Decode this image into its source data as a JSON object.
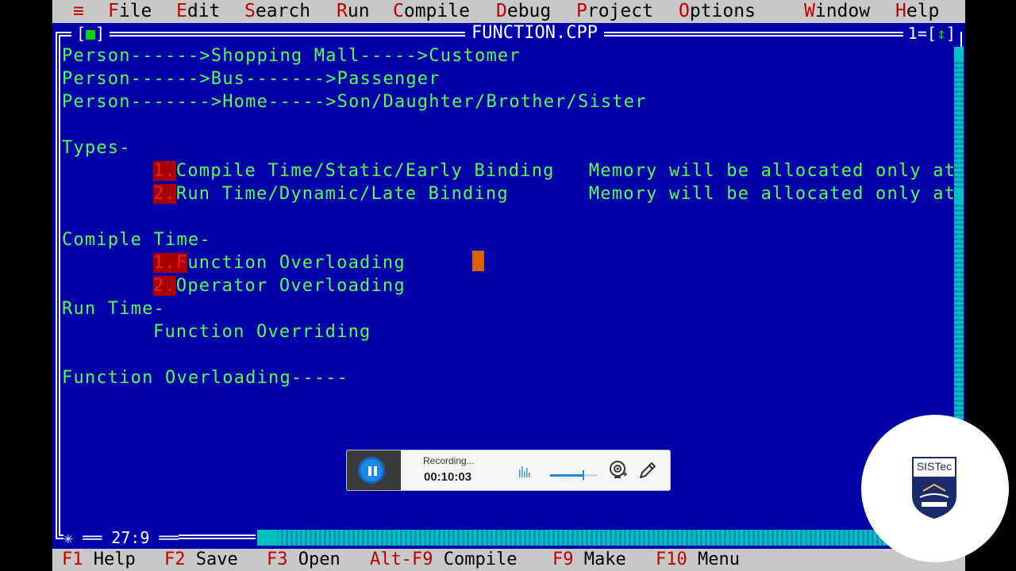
{
  "menubar": {
    "system_menu": "≡",
    "items": [
      {
        "hot": "F",
        "rest": "ile"
      },
      {
        "hot": "E",
        "rest": "dit"
      },
      {
        "hot": "S",
        "rest": "earch"
      },
      {
        "hot": "R",
        "rest": "un"
      },
      {
        "hot": "C",
        "rest": "ompile"
      },
      {
        "hot": "D",
        "rest": "ebug"
      },
      {
        "hot": "P",
        "rest": "roject"
      },
      {
        "hot": "O",
        "rest": "ptions"
      },
      {
        "hot": "W",
        "rest": "indow"
      },
      {
        "hot": "H",
        "rest": "elp"
      }
    ]
  },
  "editor": {
    "title": "FUNCTION.CPP",
    "close_box_left": "[",
    "close_box_mark": "■",
    "close_box_right": "]",
    "window_number": "1=[",
    "zoom_mark": "↕",
    "zoom_close": "]",
    "cursor_position": "27:9",
    "lines": {
      "l1": "Person------>Shopping Mall----->Customer",
      "l2": "Person------>Bus------->Passenger",
      "l3": "Person------->Home----->Son/Daughter/Brother/Sister",
      "l4": "Types-",
      "l5_num": "1.",
      "l5_text": "Compile Time/Static/Early Binding   Memory will be allocated only at",
      "l6_num": "2.",
      "l6_text": "Run Time/Dynamic/Late Binding       Memory will be allocated only at",
      "l7": "Comiple Time-",
      "l8_num": "1.F",
      "l8_text": "unction Overloading",
      "l9_num": "2.",
      "l9_text": "Operator Overloading",
      "l10": "Run Time-",
      "l11": "Function Overriding",
      "l12": "Function Overloading-----"
    }
  },
  "fkeys": [
    {
      "key": "F1",
      "label": " Help"
    },
    {
      "key": "F2",
      "label": " Save"
    },
    {
      "key": "F3",
      "label": " Open"
    },
    {
      "key": "Alt-F9",
      "label": " Compile"
    },
    {
      "key": "F9",
      "label": " Make"
    },
    {
      "key": "F10",
      "label": " Menu"
    }
  ],
  "recorder": {
    "status": "Recording...",
    "timer": "00:10:03",
    "volume": 0.7,
    "icons": [
      "pause-icon",
      "audio-level-icon",
      "webcam-icon",
      "pen-icon"
    ]
  },
  "logo": {
    "text": "SISTec"
  },
  "colors": {
    "editor_bg": "#0000a8",
    "code_text": "#54fc54",
    "menu_bg": "#c8c8c8",
    "hotkey": "#c00000",
    "recorder_accent": "#1e88e5"
  }
}
